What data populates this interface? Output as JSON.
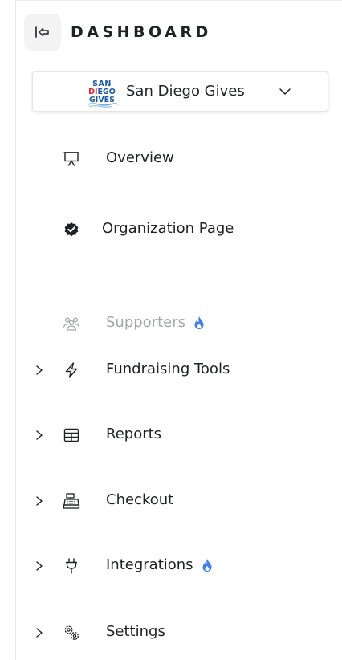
{
  "header": {
    "title": "DASHBOARD",
    "collapse_icon": "collapse-sidebar-icon"
  },
  "org": {
    "name": "San Diego Gives",
    "logo_text": [
      "SAN",
      "DIEGO",
      "GIVES"
    ],
    "logo_colors": {
      "san": "#1c5aa0",
      "diego_di": "#d9282f",
      "diego_rest": "#1c5aa0",
      "gives": "#1c5aa0"
    }
  },
  "nav": {
    "items": [
      {
        "label": "Overview",
        "icon": "presentation-icon",
        "expandable": false
      },
      {
        "label": "Organization Page",
        "icon": "verified-badge-icon",
        "expandable": false
      },
      {
        "label": "Supporters",
        "icon": "users-icon",
        "expandable": false,
        "muted": true,
        "badge": "flame-icon"
      },
      {
        "label": "Fundraising Tools",
        "icon": "lightning-icon",
        "expandable": true
      },
      {
        "label": "Reports",
        "icon": "table-icon",
        "expandable": true
      },
      {
        "label": "Checkout",
        "icon": "cash-register-icon",
        "expandable": true
      },
      {
        "label": "Integrations",
        "icon": "plug-icon",
        "expandable": true,
        "badge": "flame-icon"
      },
      {
        "label": "Settings",
        "icon": "gears-icon",
        "expandable": true
      }
    ]
  },
  "colors": {
    "text": "#1e2126",
    "muted_text": "#a3a6ab",
    "flame": "#3f7fe6",
    "collapse_bg": "#f3f3f4"
  }
}
